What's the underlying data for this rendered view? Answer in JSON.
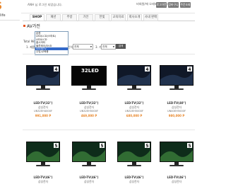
{
  "header": {
    "logo_fragment": "S",
    "login_message": "ANH 님 로그인 되었습니다.",
    "user_message": "비회원/에 오래되었습니다",
    "buttons": [
      "로그아웃",
      "장바구니",
      "주문조회"
    ]
  },
  "sidebar": {
    "title": "life"
  },
  "nav": {
    "tabs": [
      "SHOP",
      "패션",
      "주방",
      "가전",
      "한빛",
      "교육자료",
      "회사소개",
      "사내 판매"
    ],
    "active_index": 0
  },
  "section": {
    "title": "AV가전"
  },
  "filters": {
    "total_label": "Total 98",
    "category_label": "1. 제품",
    "size_label": "2 인치",
    "price_label": "3. 가격",
    "dropdown_options": [
      "분류",
      "LED/LCD(스마트)",
      "LED/LCD",
      "홈시어터",
      "블루레이/DVD",
      "인터넷TV",
      "주방/교육용"
    ],
    "dropdown_selected_index": 5,
    "size_value": "전체",
    "price_value": "전체",
    "search_button": "검색"
  },
  "products": [
    {
      "name": "LED-TV(32\")",
      "brand": "삼성전자",
      "model": "UN32EH4000F",
      "price": "991,000 P",
      "badge": "4"
    },
    {
      "name": "LED-TV(32\")",
      "brand": "삼성전자",
      "model": "UN32EH5000F",
      "price": "469,000 P",
      "badge": "32LED"
    },
    {
      "name": "LED-TV(32\")",
      "brand": "삼성전자",
      "model": "UN32EH5000F",
      "price": "680,000 P",
      "badge": "4"
    },
    {
      "name": "LED-TV(40\")",
      "brand": "삼성전자",
      "model": "UN40EH5000F",
      "price": "980,000 P",
      "badge": "4"
    },
    {
      "name": "LED-TV(46\")",
      "brand": "삼성전자",
      "model": "",
      "price": "",
      "badge": "5"
    },
    {
      "name": "LED-TV(46\")",
      "brand": "삼성전자",
      "model": "",
      "price": "",
      "badge": "5"
    },
    {
      "name": "LED-TV(46\")",
      "brand": "삼성전자",
      "model": "",
      "price": "",
      "badge": "5"
    },
    {
      "name": "LED-TV(46\")",
      "brand": "삼성전자",
      "model": "",
      "price": "",
      "badge": "5"
    }
  ],
  "colors": {
    "accent": "#e8862a",
    "selection": "#3369c9",
    "price": "#e8862a"
  }
}
